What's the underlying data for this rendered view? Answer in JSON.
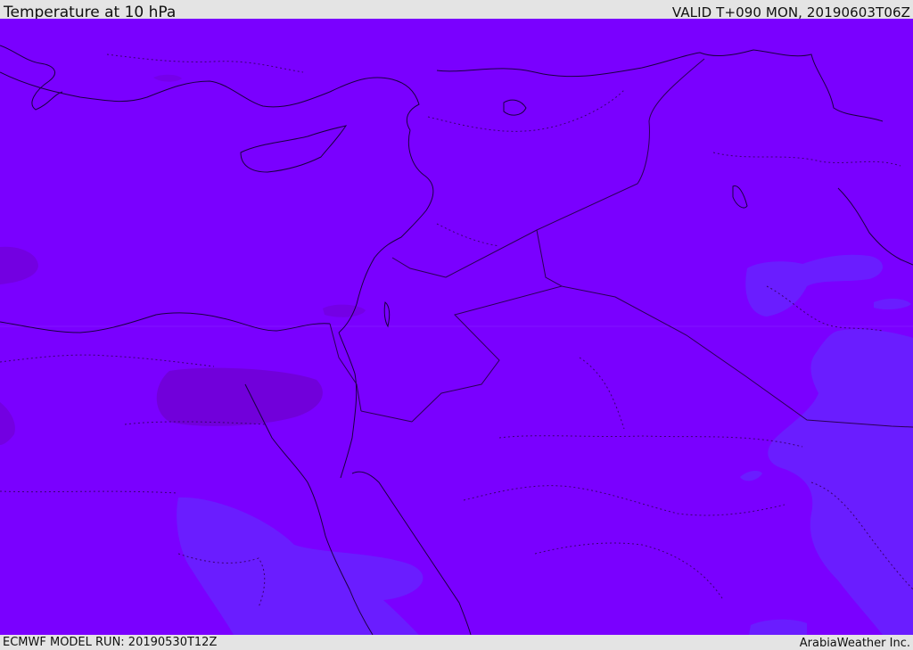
{
  "header": {
    "title": "Temperature at 10 hPa",
    "valid_time": "VALID T+090 MON, 20190603T06Z"
  },
  "footer": {
    "model_run": "ECMWF MODEL RUN: 20190530T12Z",
    "credit": "ArabiaWeather Inc."
  },
  "map": {
    "colors": {
      "base_fill": "#7a00ff",
      "warm_patch": "#7000d4",
      "cool_patch": "#6a1dff",
      "coast": "#1a0040",
      "border": "#2a0055"
    }
  }
}
